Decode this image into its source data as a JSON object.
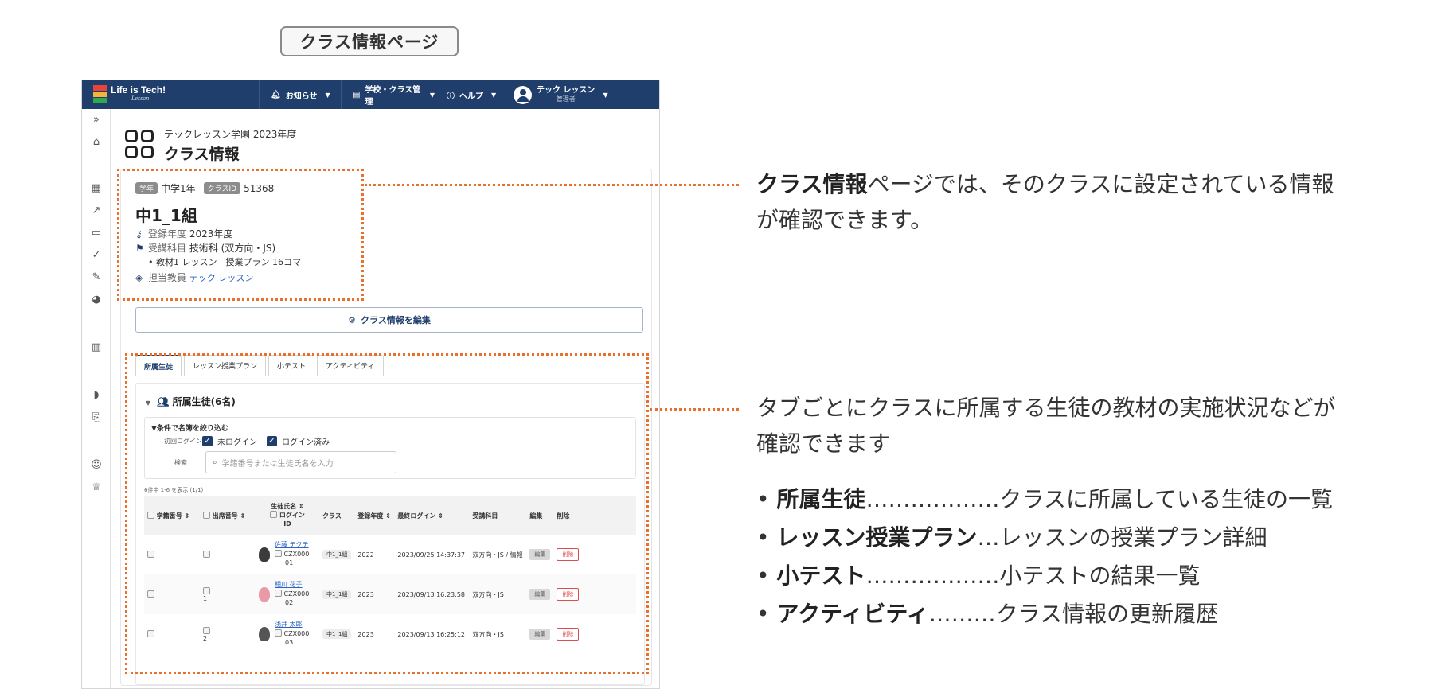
{
  "page_label": "クラス情報ページ",
  "app": {
    "logo_text": "Life is Tech!",
    "logo_sub": "Lesson",
    "nav": [
      {
        "label": "お知らせ",
        "icon": "bell-icon"
      },
      {
        "label": "学校・クラス管理",
        "icon": "building-icon"
      },
      {
        "label": "ヘルプ",
        "icon": "help-icon"
      }
    ],
    "user": {
      "name": "テック レッスン",
      "role": "管理者"
    }
  },
  "header": {
    "school": "テックレッスン学園 2023年度",
    "title": "クラス情報"
  },
  "class_info": {
    "grade_badge": "学年",
    "grade": "中学1年",
    "id_badge": "クラスID",
    "class_id": "51368",
    "name": "中1_1組",
    "year_label": "登録年度",
    "year": "2023年度",
    "subject_label": "受講科目",
    "subject": "技術科 (双方向・JS)",
    "material_line": "• 教材1 レッスン　授業プラン  16コマ",
    "teacher_label": "担当教員",
    "teacher": "テック レッスン",
    "edit_button": "クラス情報を編集"
  },
  "tabs": [
    "所属生徒",
    "レッスン授業プラン",
    "小テスト",
    "アクティビティ"
  ],
  "students_panel": {
    "title": "所属生徒(6名)",
    "filter_title": "▼条件で名簿を絞り込む",
    "login_label": "初回ログイン",
    "opt_not_logged": "未ログイン",
    "opt_logged": "ログイン済み",
    "search_label": "検索",
    "search_placeholder": "学籍番号または生徒氏名を入力",
    "count_text": "6件中 1-6 を表示 (1/1)",
    "columns": [
      "学籍番号 ⇕",
      "出席番号 ⇕",
      "生徒氏名 ⇕",
      "ログイン",
      "ID",
      "クラス",
      "登録年度 ⇕",
      "最終ログイン ⇕",
      "受講科目",
      "編集",
      "削除"
    ],
    "rows": [
      {
        "att": "",
        "name": "佐藤 テクテ",
        "login_id_1": "CZX000",
        "login_id_2": "01",
        "cls": "中1_1組",
        "year": "2022",
        "last": "2023/09/25 14:37:37",
        "subject": "双方向・JS / 情報",
        "edit": "編集",
        "del": "削除"
      },
      {
        "att": "1",
        "name": "相川 花子",
        "login_id_1": "CZX000",
        "login_id_2": "02",
        "cls": "中1_1組",
        "year": "2023",
        "last": "2023/09/13 16:23:58",
        "subject": "双方向・JS",
        "edit": "編集",
        "del": "削除"
      },
      {
        "att": "2",
        "name": "浅井 太郎",
        "login_id_1": "CZX000",
        "login_id_2": "03",
        "cls": "中1_1組",
        "year": "2023",
        "last": "2023/09/13 16:25:12",
        "subject": "双方向・JS",
        "edit": "編集",
        "del": "削除"
      }
    ]
  },
  "explanations": {
    "p1_bold": "クラス情報",
    "p1_rest_a": "ページでは、そのクラスに設定されている情報",
    "p1_rest_b": "が確認できます。",
    "p2_a": "タブごとにクラスに所属する生徒の教材の実施状況などが",
    "p2_b": "確認できます",
    "bullets": [
      {
        "bold": "所属生徒",
        "dots": "………………",
        "text": "クラスに所属している生徒の一覧"
      },
      {
        "bold": "レッスン授業プラン",
        "dots": "…",
        "text": "レッスンの授業プラン詳細"
      },
      {
        "bold": "小テスト",
        "dots": "………………",
        "text": "小テストの結果一覧"
      },
      {
        "bold": "アクティビティ",
        "dots": "………",
        "text": "クラス情報の更新履歴"
      }
    ]
  },
  "colors": {
    "navbar": "#1f3e6b",
    "highlight": "#e8702a",
    "link": "#2a64c4",
    "delete": "#e04b4b"
  }
}
